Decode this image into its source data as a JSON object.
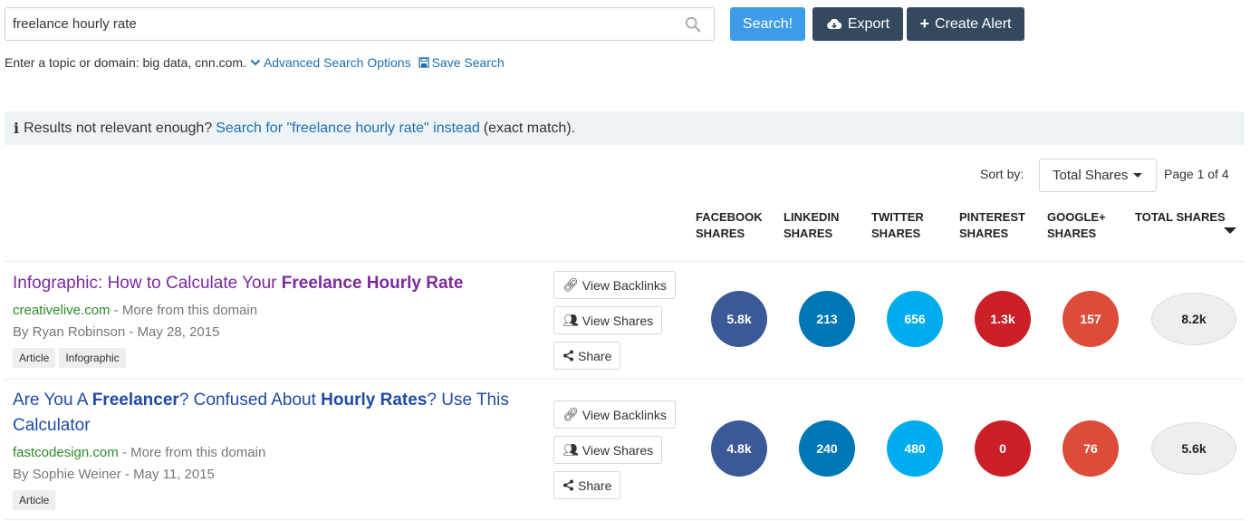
{
  "search": {
    "value": "freelance hourly rate",
    "placeholder": ""
  },
  "buttons": {
    "search_label": "Search!",
    "export_label": "Export",
    "create_alert_label": "Create Alert"
  },
  "hint": {
    "text": "Enter a topic or domain: big data, cnn.com.",
    "advanced_label": "Advanced Search Options",
    "save_label": "Save Search"
  },
  "notice": {
    "prefix": "Results not relevant enough?",
    "link": "Search for \"freelance hourly rate\" instead",
    "suffix": "(exact match)."
  },
  "sort": {
    "label": "Sort by:",
    "selected": "Total Shares",
    "page_info": "Page 1 of 4"
  },
  "columns": [
    {
      "line1": "FACEBOOK",
      "line2": "SHARES"
    },
    {
      "line1": "LINKEDIN",
      "line2": "SHARES"
    },
    {
      "line1": "TWITTER",
      "line2": "SHARES"
    },
    {
      "line1": "PINTEREST",
      "line2": "SHARES"
    },
    {
      "line1": "GOOGLE+",
      "line2": "SHARES"
    },
    {
      "line1": "TOTAL SHARES",
      "line2": ""
    }
  ],
  "actions": {
    "backlinks": "View Backlinks",
    "shares": "View Shares",
    "share": "Share"
  },
  "colors": {
    "facebook": "#3b5998",
    "linkedin": "#0077b5",
    "twitter": "#00aced",
    "pinterest": "#cb2027",
    "googleplus": "#dd4b39",
    "visited_title": "#7b2a9b",
    "link_title": "#1f4aa8"
  },
  "results": [
    {
      "title_parts": [
        {
          "text": "Infographic: How to Calculate Your ",
          "bold": false
        },
        {
          "text": "Freelance Hourly Rate",
          "bold": true
        }
      ],
      "domain": "creativelive.com",
      "more": "- More from this domain",
      "byline": "By Ryan Robinson - May 28, 2015",
      "tags": [
        "Article",
        "Infographic"
      ],
      "shares": {
        "facebook": "5.8k",
        "linkedin": "213",
        "twitter": "656",
        "pinterest": "1.3k",
        "googleplus": "157",
        "total": "8.2k"
      }
    },
    {
      "title_parts": [
        {
          "text": "Are You A ",
          "bold": false
        },
        {
          "text": "Freelancer",
          "bold": true
        },
        {
          "text": "? Confused About ",
          "bold": false
        },
        {
          "text": "Hourly Rates",
          "bold": true
        },
        {
          "text": "? Use This Calculator",
          "bold": false
        }
      ],
      "domain": "fastcodesign.com",
      "more": "- More from this domain",
      "byline": "By Sophie Weiner - May 11, 2015",
      "tags": [
        "Article"
      ],
      "shares": {
        "facebook": "4.8k",
        "linkedin": "240",
        "twitter": "480",
        "pinterest": "0",
        "googleplus": "76",
        "total": "5.6k"
      }
    }
  ]
}
